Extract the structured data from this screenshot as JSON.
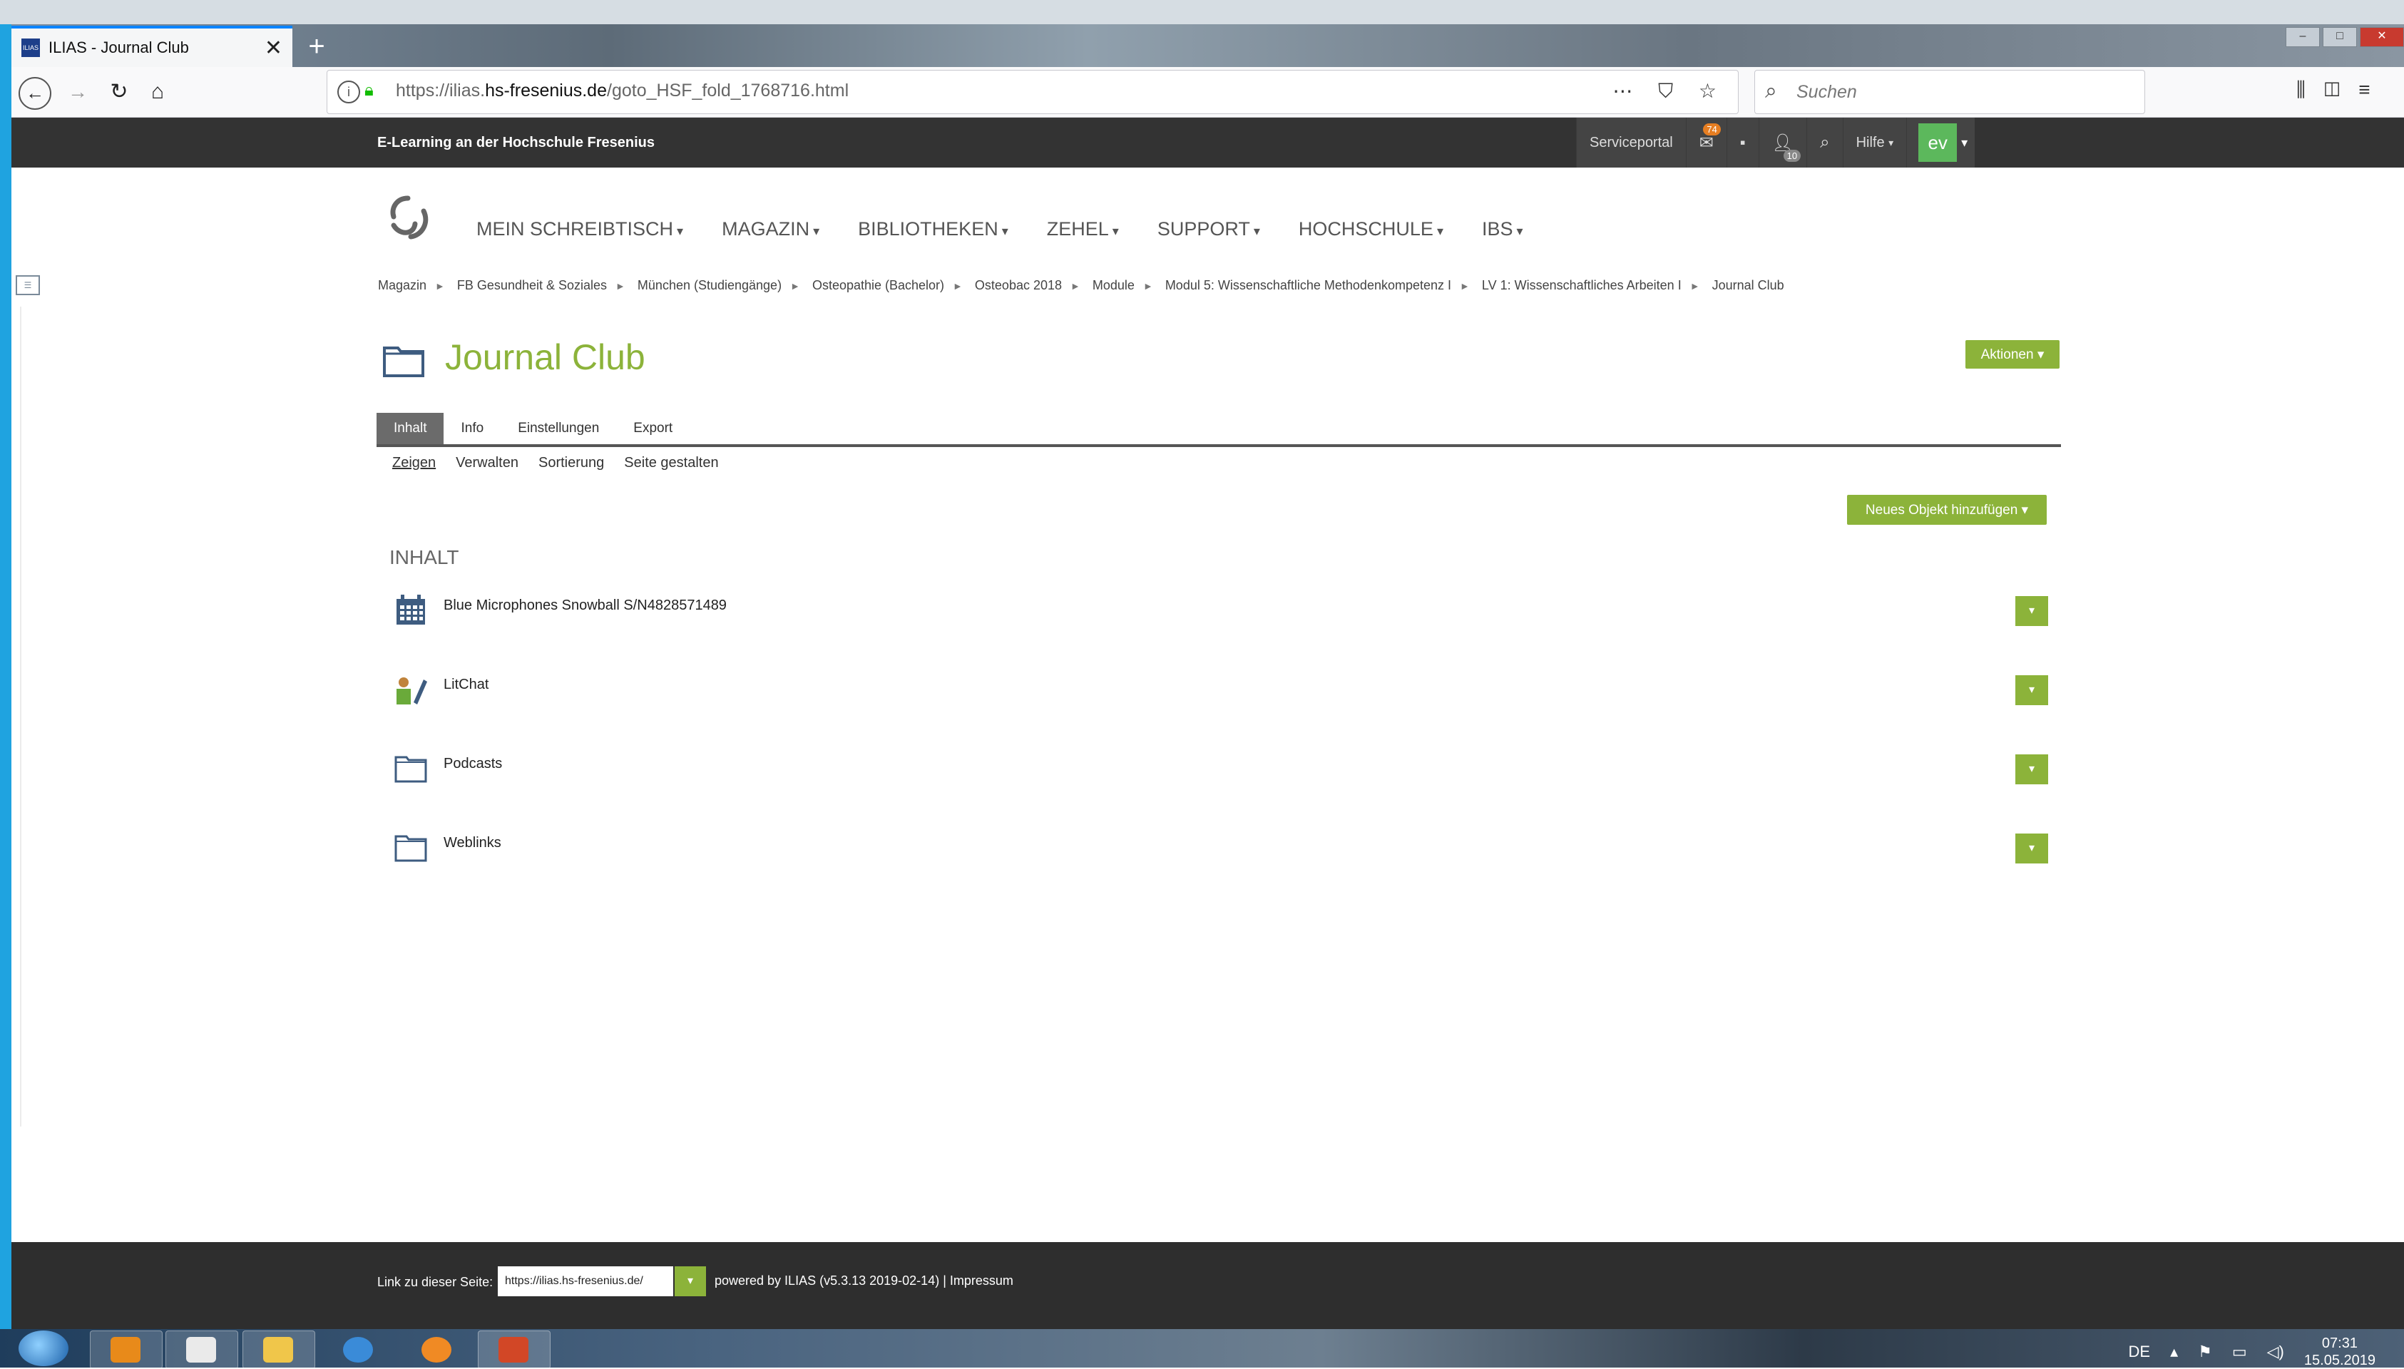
{
  "browser": {
    "tab_title": "ILIAS - Journal Club",
    "tab_favicon_text": "ILIAS",
    "url_host_prefix": "https://ilias.",
    "url_host_strong": "hs-fresenius.de",
    "url_path": "/goto_HSF_fold_1768716.html",
    "search_placeholder": "Suchen"
  },
  "topbar": {
    "title": "E-Learning an der Hochschule Fresenius",
    "serviceportal": "Serviceportal",
    "mail_count": "74",
    "contacts_count": "10",
    "help_label": "Hilfe",
    "user_initials": "ev"
  },
  "mainnav": {
    "items": [
      "MEIN SCHREIBTISCH",
      "MAGAZIN",
      "BIBLIOTHEKEN",
      "ZEHEL",
      "SUPPORT",
      "HOCHSCHULE",
      "IBS"
    ]
  },
  "breadcrumb": [
    "Magazin",
    "FB Gesundheit & Soziales",
    "München (Studiengänge)",
    "Osteopathie (Bachelor)",
    "Osteobac 2018",
    "Module",
    "Modul 5: Wissenschaftliche Methodenkompetenz I",
    "LV 1: Wissenschaftliches Arbeiten I",
    "Journal Club"
  ],
  "page": {
    "title": "Journal Club",
    "actions_label": "Aktionen ▾",
    "tabs": [
      "Inhalt",
      "Info",
      "Einstellungen",
      "Export"
    ],
    "subtabs": [
      "Zeigen",
      "Verwalten",
      "Sortierung",
      "Seite gestalten"
    ],
    "add_object_label": "Neues Objekt hinzufügen ▾",
    "section_title": "INHALT",
    "items": [
      {
        "label": "Blue Microphones Snowball S/N4828571489",
        "icon": "calendar-icon"
      },
      {
        "label": "LitChat",
        "icon": "chat-icon"
      },
      {
        "label": "Podcasts",
        "icon": "folder-icon"
      },
      {
        "label": "Weblinks",
        "icon": "folder-icon"
      }
    ]
  },
  "footer": {
    "link_label": "Link zu dieser Seite:",
    "link_value": "https://ilias.hs-fresenius.de/",
    "powered": "powered by ILIAS (v5.3.13 2019-02-14) | Impressum"
  },
  "taskbar": {
    "language": "DE",
    "time": "07:31",
    "date": "15.05.2019"
  },
  "colors": {
    "accent_green": "#8cb33a",
    "topbar_bg": "#333333",
    "avatar_green": "#5cb85c",
    "badge_orange": "#e67e22"
  }
}
